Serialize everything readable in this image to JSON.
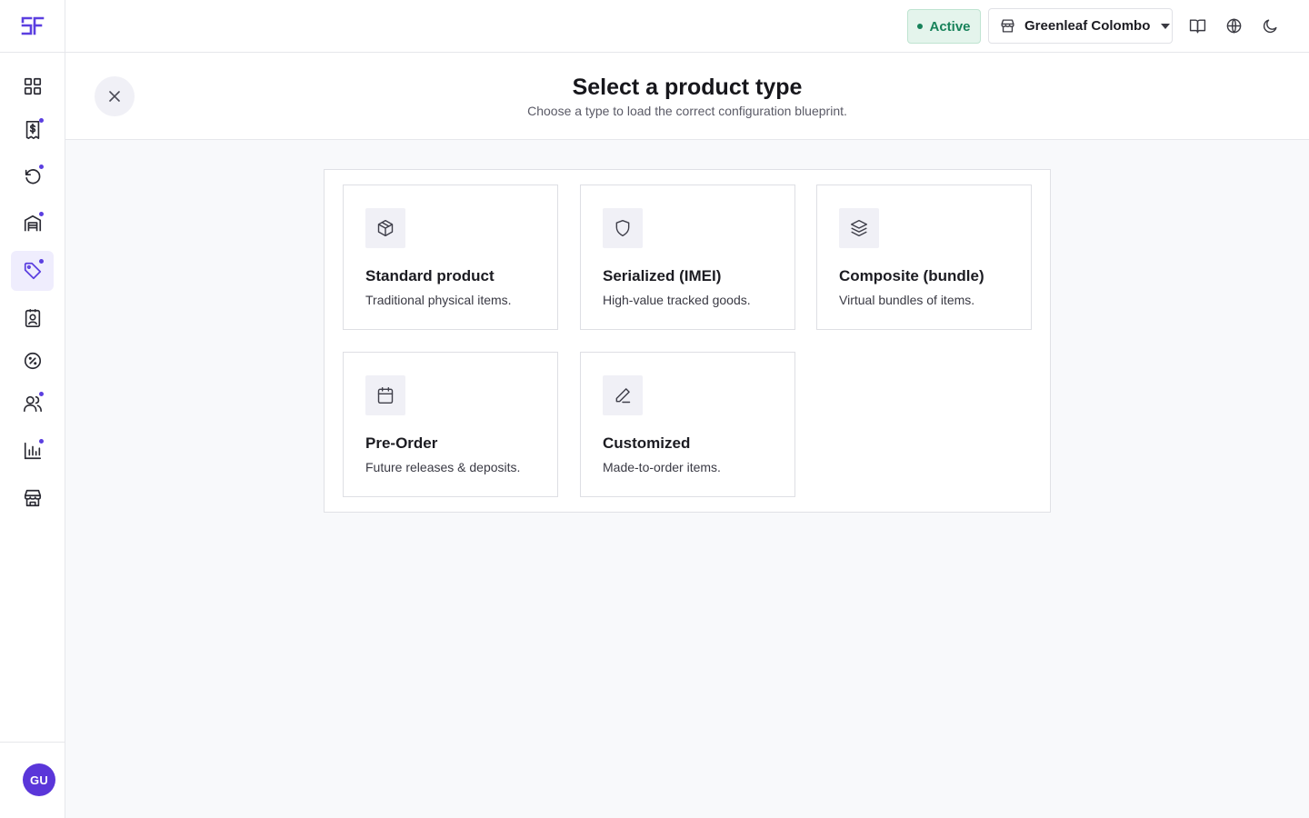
{
  "sidebar": {
    "logo": "SF",
    "items": [
      {
        "name": "dashboard",
        "icon": "grid-icon",
        "dot": false,
        "active": false
      },
      {
        "name": "sales",
        "icon": "receipt-dollar-icon",
        "dot": true,
        "active": false
      },
      {
        "name": "returns",
        "icon": "refresh-icon",
        "dot": true,
        "active": false
      },
      {
        "name": "inventory",
        "icon": "warehouse-icon",
        "dot": true,
        "active": false
      },
      {
        "name": "products",
        "icon": "tag-icon",
        "dot": true,
        "active": true
      },
      {
        "name": "contacts",
        "icon": "contact-card-icon",
        "dot": false,
        "active": false
      },
      {
        "name": "discounts",
        "icon": "percent-badge-icon",
        "dot": false,
        "active": false
      },
      {
        "name": "customers",
        "icon": "users-icon",
        "dot": true,
        "active": false
      },
      {
        "name": "reports",
        "icon": "bar-chart-icon",
        "dot": true,
        "active": false
      },
      {
        "name": "stores",
        "icon": "store-icon",
        "dot": false,
        "active": false
      }
    ],
    "avatar_initials": "GU"
  },
  "header": {
    "status": "Active",
    "store_name": "Greenleaf Colombo",
    "icons": [
      "book-icon",
      "globe-icon",
      "moon-icon"
    ]
  },
  "page": {
    "title": "Select a product type",
    "subtitle": "Choose a type to load the correct configuration blueprint."
  },
  "product_types": [
    {
      "title": "Standard product",
      "desc": "Traditional physical items.",
      "icon": "box-icon"
    },
    {
      "title": "Serialized (IMEI)",
      "desc": "High-value tracked goods.",
      "icon": "shield-icon"
    },
    {
      "title": "Composite (bundle)",
      "desc": "Virtual bundles of items.",
      "icon": "layers-icon"
    },
    {
      "title": "Pre-Order",
      "desc": "Future releases & deposits.",
      "icon": "calendar-icon"
    },
    {
      "title": "Customized",
      "desc": "Made-to-order items.",
      "icon": "pen-icon"
    }
  ],
  "colors": {
    "accent": "#5b3fe0",
    "avatar": "#5a36d9",
    "status_green": "#17825a",
    "status_bg": "#e4f4ec"
  }
}
